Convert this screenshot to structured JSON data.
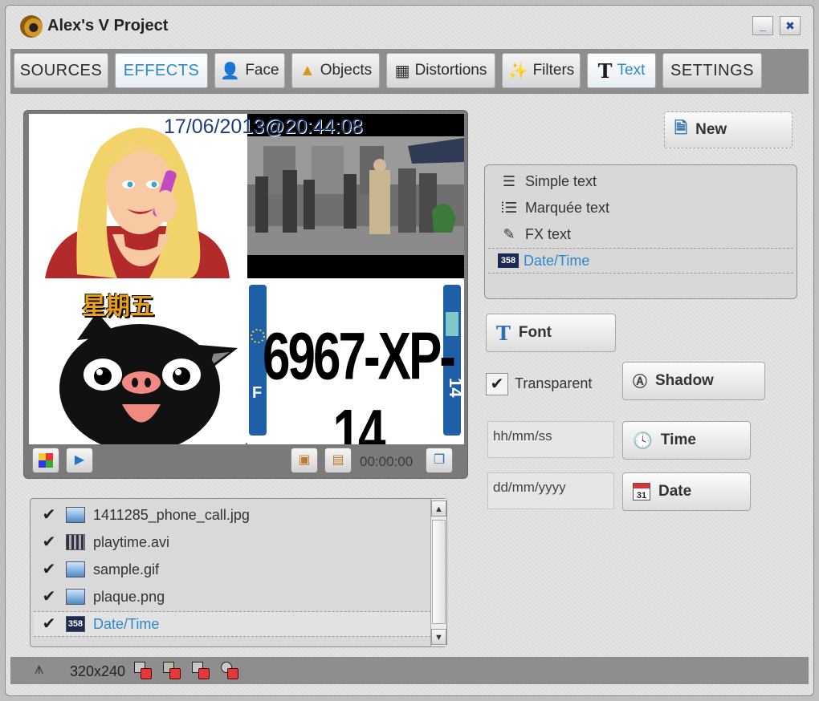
{
  "window": {
    "title": "Alex's V Project",
    "minimize_label": "_",
    "close_label": "✖"
  },
  "tabs": [
    {
      "label": "SOURCES",
      "icon": null
    },
    {
      "label": "EFFECTS",
      "icon": null,
      "active": true
    },
    {
      "label": "Face",
      "icon": "face-icon"
    },
    {
      "label": "Objects",
      "icon": "cone-icon"
    },
    {
      "label": "Distortions",
      "icon": "distortion-icon"
    },
    {
      "label": "Filters",
      "icon": "filter-wand-icon"
    },
    {
      "label": "Text",
      "icon": "text-t-icon",
      "active": true
    },
    {
      "label": "SETTINGS",
      "icon": null
    }
  ],
  "preview": {
    "timestamp": "17/06/2013@20:44:08",
    "pig_caption": "星期五",
    "plate_text": "6967-XP-14",
    "plate_left_letter": "F",
    "plate_right_number": "14",
    "time_readout": "00:00:00"
  },
  "files": [
    {
      "name": "1411285_phone_call.jpg",
      "type": "image",
      "checked": true
    },
    {
      "name": "playtime.avi",
      "type": "video",
      "checked": true
    },
    {
      "name": "sample.gif",
      "type": "image",
      "checked": true
    },
    {
      "name": "plaque.png",
      "type": "image",
      "checked": true
    },
    {
      "name": "Date/Time",
      "type": "datetime",
      "checked": true,
      "selected": true
    }
  ],
  "text_panel": {
    "new_label": "New",
    "items": [
      {
        "label": "Simple text",
        "icon": "simple-text-icon"
      },
      {
        "label": "Marquée text",
        "icon": "marquee-text-icon"
      },
      {
        "label": "FX text",
        "icon": "fx-text-icon"
      },
      {
        "label": "Date/Time",
        "icon": "datetime-icon",
        "selected": true
      }
    ],
    "datetime_icon_text": "358",
    "font_label": "Font",
    "transparent_label": "Transparent",
    "transparent_checked": true,
    "shadow_label": "Shadow",
    "time_format": "hh/mm/ss",
    "time_label": "Time",
    "date_format": "dd/mm/yyyy",
    "date_label": "Date",
    "calendar_day": "31"
  },
  "status": {
    "resolution": "320x240"
  },
  "colors": {
    "accent": "#2f87c8",
    "tabbar": "#8e8e8e",
    "status_red": "#e03a3a"
  }
}
